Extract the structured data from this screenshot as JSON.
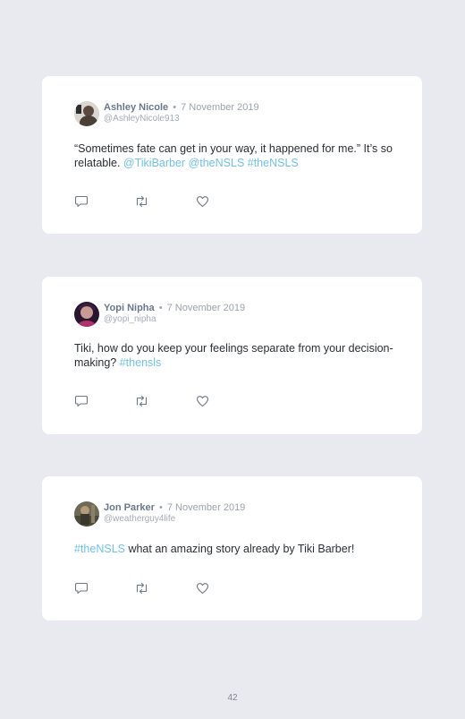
{
  "tweets": [
    {
      "name": "Ashley Nicole",
      "date": "7 November 2019",
      "handle": "@AshleyNicole913",
      "text_before": "“Sometimes fate can get in your way, it happened for me.” It’s so relatable. ",
      "highlight": "@TikiBarber @theNSLS #theNSLS",
      "text_after": ""
    },
    {
      "name": "Yopi Nipha",
      "date": "7 November 2019",
      "handle": "@yopi_nipha",
      "text_before": "Tiki, how do you keep your feelings separate from your decision-making? ",
      "highlight": "#thensls",
      "text_after": ""
    },
    {
      "name": "Jon Parker",
      "date": "7 November 2019",
      "handle": "@weatherguy4life",
      "text_before": "",
      "highlight": "#theNSLS",
      "text_after": " what an amazing story already by Tiki Barber!"
    }
  ],
  "separator": "•",
  "icons": [
    "reply-icon",
    "retweet-icon",
    "like-icon"
  ],
  "page_number": "42",
  "colors": {
    "background": "#e9eaef",
    "card": "#ffffff",
    "accent": "#6ec2e8",
    "name": "#68788a",
    "meta": "#9aa3ad"
  }
}
